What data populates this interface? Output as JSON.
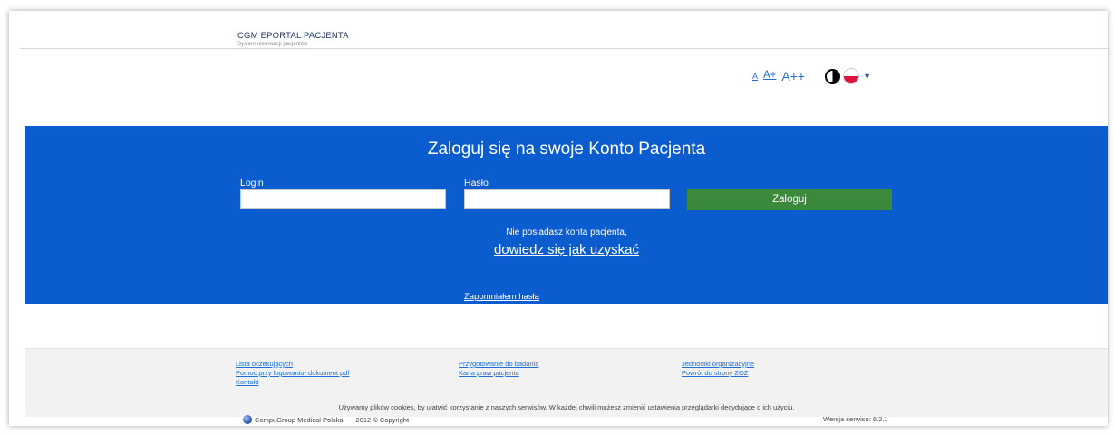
{
  "header": {
    "brand_title": "CGM EPORTAL PACJENTA",
    "brand_subtitle": "System rezerwacji pacjentów"
  },
  "tools": {
    "font_small": "A",
    "font_medium": "A+",
    "font_large": "A++",
    "contrast_icon": "contrast-icon",
    "language_icon": "flag-pl-icon",
    "dropdown_icon": "caret-down-icon"
  },
  "login": {
    "title": "Zaloguj się na swoje Konto Pacjenta",
    "login_label": "Login",
    "login_value": "",
    "password_label": "Hasło",
    "password_value": "",
    "submit_label": "Zaloguj",
    "no_account_text": "Nie posiadasz konta pacjenta,",
    "learn_link": "dowiedz się jak uzyskać",
    "forgot_link": "Zapomniałem hasła"
  },
  "footer": {
    "links_col1": [
      "Lista oczekujących",
      "Pomoc przy logowaniu- dokument pdf",
      "Kontakt"
    ],
    "links_col2": [
      "Przygotowanie do badania",
      "Karta praw pacjenta"
    ],
    "links_col3": [
      "Jednostki organizacyjne",
      "Powrót do strony ZOZ"
    ],
    "cookie_notice": "Używamy plików cookies, by ułatwić korzystanie z naszych serwisów. W każdej chwili możesz zmienić ustawienia przeglądarki decydujące o ich użyciu.",
    "company": "CompuGroup Medical Polska",
    "copyright": "2012 © Copyright",
    "version": "Wersja serwisu: 6.2.1"
  },
  "colors": {
    "banner": "#0b5ccf",
    "button": "#3b8a3b",
    "link": "#1e6fd6"
  }
}
